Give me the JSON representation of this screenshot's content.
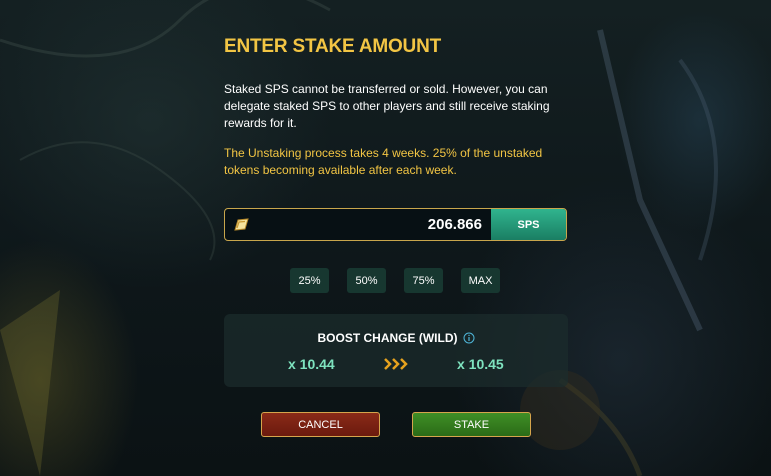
{
  "dialog": {
    "title": "ENTER STAKE AMOUNT",
    "description": "Staked SPS cannot be transferred or sold. However, you can delegate staked SPS to other players and still receive staking rewards for it.",
    "unstaking_note": "The Unstaking process takes 4 weeks. 25% of the unstaked tokens becoming available after each week."
  },
  "amount_input": {
    "value": "206.866",
    "token": "SPS",
    "icon": "sps-token-icon"
  },
  "percent_buttons": [
    {
      "label": "25%"
    },
    {
      "label": "50%"
    },
    {
      "label": "75%"
    },
    {
      "label": "MAX"
    }
  ],
  "boost": {
    "title": "BOOST CHANGE (WILD)",
    "from": "x 10.44",
    "to": "x 10.45",
    "icon_info": "info-icon",
    "icon_arrows": "triple-chevron-right-icon"
  },
  "buttons": {
    "cancel": "CANCEL",
    "stake": "STAKE"
  },
  "colors": {
    "accent_gold": "#f2c544",
    "token_green": "#1fa07c",
    "boost_value": "#7ee3bf",
    "cancel_red": "#7a2214",
    "stake_green": "#357d1e"
  }
}
